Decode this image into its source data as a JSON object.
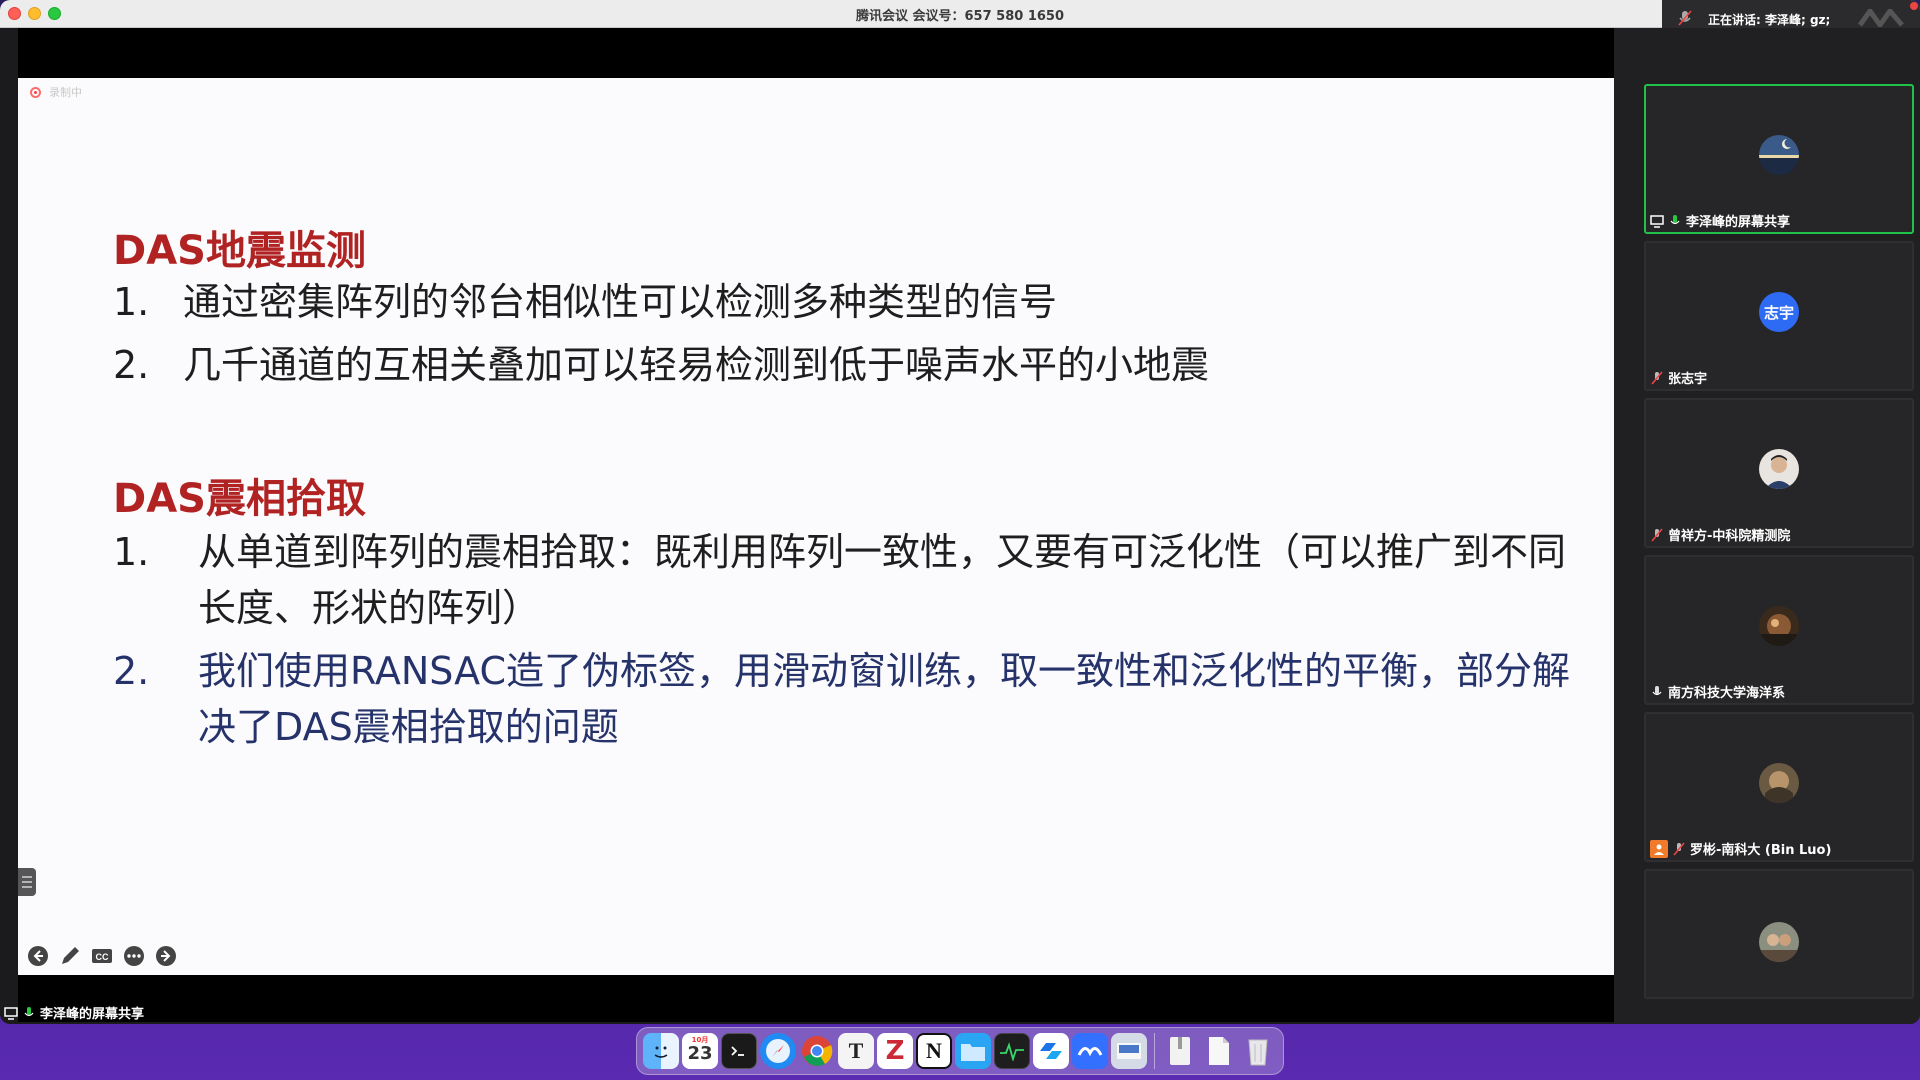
{
  "window": {
    "title": "腾讯会议 会议号：657 580 1650",
    "speaking": "正在讲话: 李泽峰; gz;"
  },
  "slide": {
    "recording_label": "录制中",
    "section1": {
      "heading": "DAS地震监测",
      "items": [
        {
          "num": "1.",
          "text": "通过密集阵列的邻台相似性可以检测多种类型的信号"
        },
        {
          "num": "2.",
          "text": "几千通道的互相关叠加可以轻易检测到低于噪声水平的小地震"
        }
      ]
    },
    "section2": {
      "heading": "DAS震相拾取",
      "items": [
        {
          "num": "1.",
          "text": "从单道到阵列的震相拾取：既利用阵列一致性，又要有可泛化性（可以推广到不同长度、形状的阵列）"
        },
        {
          "num": "2.",
          "text": "我们使用RANSAC造了伪标签，用滑动窗训练，取一致性和泛化性的平衡，部分解决了DAS震相拾取的问题"
        }
      ]
    },
    "controls": [
      "prev-icon",
      "pen-icon",
      "cc-icon",
      "more-icon",
      "next-icon"
    ]
  },
  "share_label": "李泽峰的屏幕共享",
  "participants": [
    {
      "name": "李泽峰的屏幕共享",
      "avatar": "landscape",
      "active": true
    },
    {
      "name": "张志宇",
      "avatar_text": "志宇"
    },
    {
      "name": "曾祥方-中科院精测院",
      "avatar": "photo"
    },
    {
      "name": "南方科技大学海洋系",
      "avatar": "photo"
    },
    {
      "name": "罗彬-南科大 (Bin Luo)",
      "avatar": "photo"
    },
    {
      "name": "",
      "avatar": "photo"
    }
  ],
  "dock": {
    "calendar_month": "10月",
    "calendar_day": "23",
    "apps": [
      "finder",
      "calendar",
      "terminal",
      "safari",
      "chrome",
      "typora",
      "zotero",
      "notion",
      "finder-blue",
      "activity-monitor",
      "tencent-meeting",
      "feishu",
      "preview",
      "files",
      "documents",
      "trash"
    ]
  },
  "colors": {
    "heading_red": "#b12323",
    "body_blue": "#26336b",
    "active_green": "#20c24a",
    "avatar_blue": "#2e6bf5"
  }
}
